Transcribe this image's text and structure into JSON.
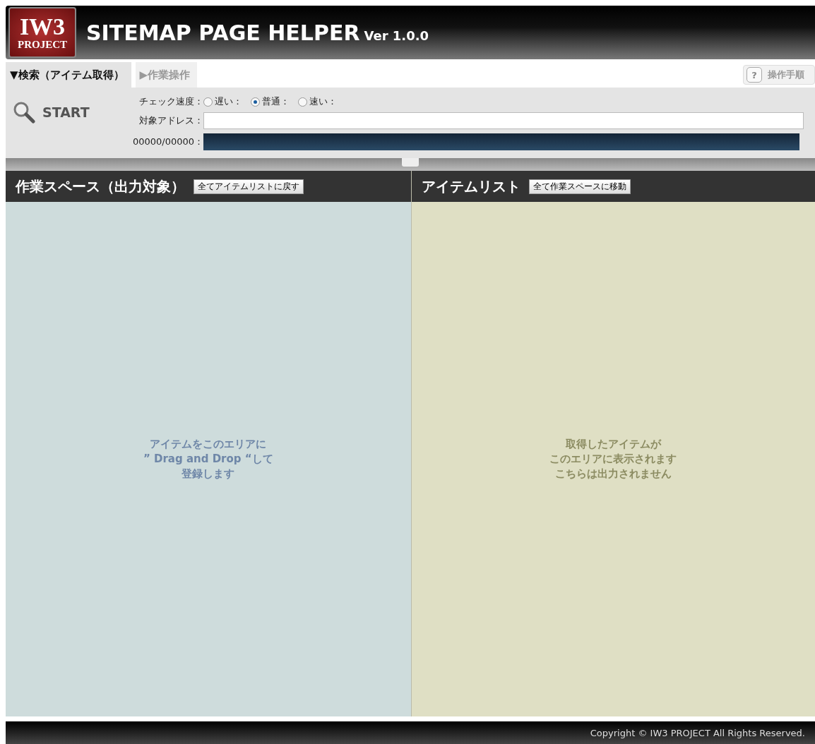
{
  "header": {
    "logo_top": "IW3",
    "logo_bottom": "PROJECT",
    "title": "SITEMAP PAGE HELPER",
    "version": "Ver 1.0.0"
  },
  "tabs": [
    {
      "label": "▼検索（アイテム取得）",
      "selected": true
    },
    {
      "label": "▶作業操作",
      "selected": false
    }
  ],
  "help_button": {
    "icon": "?",
    "label": "操作手順"
  },
  "start_button": {
    "label": "START"
  },
  "speed": {
    "label": "チェック速度：",
    "options": [
      {
        "label": "遅い：",
        "selected": false
      },
      {
        "label": "普通：",
        "selected": true
      },
      {
        "label": "速い：",
        "selected": false
      }
    ]
  },
  "address": {
    "label": "対象アドレス："
  },
  "progress": {
    "label": "00000/00000：",
    "level": 1
  },
  "panels": [
    {
      "title": "作業スペース（出力対象）",
      "button": "全てアイテムリストに戻す",
      "hint": [
        "アイテムをこのエリアに",
        "” Drag and Drop “して",
        "登録します"
      ],
      "kind": "workspace"
    },
    {
      "title": "アイテムリスト",
      "button": "全て作業スペースに移動",
      "hint": [
        "取得したアイテムが",
        "このエリアに表示されます",
        "こちらは出力されません"
      ],
      "kind": "items"
    }
  ],
  "footer": {
    "copyright": "Copyright © IW3 PROJECT All Rights Reserved."
  }
}
